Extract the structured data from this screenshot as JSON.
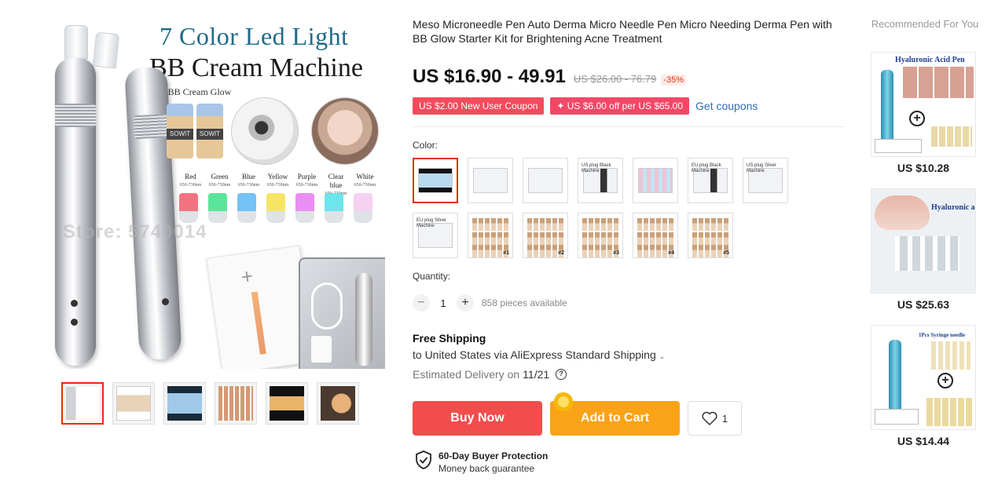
{
  "gallery": {
    "hero_title_1": "7 Color Led Light",
    "hero_title_2": "BB Cream Machine",
    "hero_subtitle": "For BB Cream Glow",
    "vial_label": "SOWIT",
    "watermark": "Store: 5740014",
    "led_colors": [
      {
        "name": "Red",
        "range": "650-730nm",
        "color": "#f25a6a"
      },
      {
        "name": "Green",
        "range": "650-730nm",
        "color": "#3ee08a"
      },
      {
        "name": "Blue",
        "range": "650-730nm",
        "color": "#5bb8f4"
      },
      {
        "name": "Yellow",
        "range": "650-730nm",
        "color": "#f4e04a"
      },
      {
        "name": "Purple",
        "range": "650-730nm",
        "color": "#e57af0"
      },
      {
        "name": "Clear blue",
        "range": "650-730nm",
        "color": "#52e2e8"
      },
      {
        "name": "White",
        "range": "650-730nm",
        "color": "#f3c9ef"
      }
    ],
    "thumbnails": [
      "thumb-1",
      "thumb-2",
      "thumb-3",
      "thumb-4",
      "thumb-5",
      "thumb-6"
    ]
  },
  "product": {
    "title": "Meso Microneedle Pen Auto Derma Micro Needle Pen Micro Needing Derma Pen with BB Glow Starter Kit for Brightening Acne Treatment",
    "price": "US $16.90 - 49.91",
    "original_price": "US $26.00 - 76.79",
    "discount": "-35%",
    "coupons": {
      "new_user": "US $2.00 New User Coupon",
      "off_per": "✦ US $6.00 off per US $65.00",
      "get_coupons": "Get coupons"
    },
    "color_label": "Color:",
    "color_options": [
      {
        "text": "",
        "num": ""
      },
      {
        "text": "",
        "num": ""
      },
      {
        "text": "",
        "num": ""
      },
      {
        "text": "US plug    Black Machine",
        "num": ""
      },
      {
        "text": "",
        "num": ""
      },
      {
        "text": "EU plug    Black Machine",
        "num": ""
      },
      {
        "text": "US plug    Silver Machine",
        "num": ""
      },
      {
        "text": "EU plug    Silver Machine",
        "num": ""
      },
      {
        "text": "",
        "num": "#1"
      },
      {
        "text": "",
        "num": "#2"
      },
      {
        "text": "",
        "num": "#3"
      },
      {
        "text": "",
        "num": "#4"
      },
      {
        "text": "",
        "num": "#5"
      }
    ],
    "quantity_label": "Quantity:",
    "quantity": "1",
    "quantity_minus": "−",
    "quantity_plus": "+",
    "available": "858 pieces available",
    "shipping": {
      "title": "Free Shipping",
      "to": "to United States via AliExpress Standard Shipping",
      "eta_label": "Estimated Delivery on",
      "eta_date": "11/21"
    },
    "buttons": {
      "buy_now": "Buy Now",
      "add_to_cart": "Add to Cart",
      "wishlist_count": "1"
    },
    "protection": {
      "title": "60-Day Buyer Protection",
      "subtitle": "Money back guarantee"
    }
  },
  "recommended": {
    "title": "Recommended For You",
    "items": [
      {
        "price": "US $10.28",
        "caption": "Hyaluronic Acid Pen"
      },
      {
        "price": "US $25.63",
        "caption": "Hyaluronic acid"
      },
      {
        "price": "US $14.44",
        "caption": "1Pcs Syringe needle"
      }
    ]
  },
  "colors": {
    "accent_red": "#e62e04",
    "buy_now": "#f14d4d",
    "add_to_cart": "#fba317",
    "link_blue": "#2e6cb8"
  }
}
